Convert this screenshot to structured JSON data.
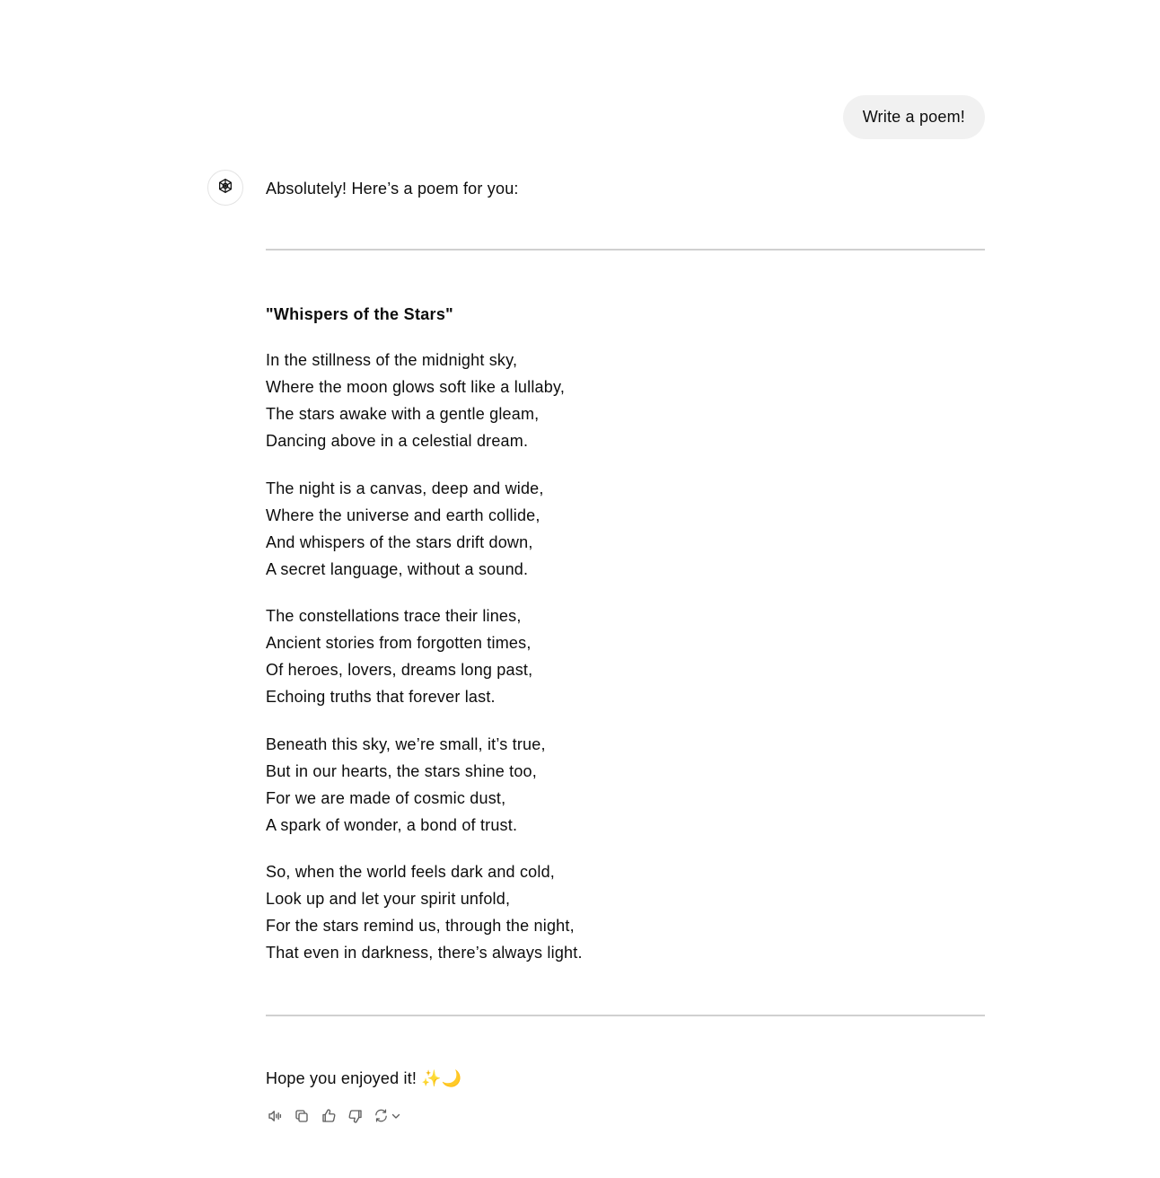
{
  "user_message": "Write a poem!",
  "assistant": {
    "avatar_icon": "openai-logo-icon",
    "intro": "Absolutely! Here’s a poem for you:",
    "poem_title": "\"Whispers of the Stars\"",
    "stanzas": [
      [
        "In the stillness of the midnight sky,",
        "Where the moon glows soft like a lullaby,",
        "The stars awake with a gentle gleam,",
        "Dancing above in a celestial dream."
      ],
      [
        "The night is a canvas, deep and wide,",
        "Where the universe and earth collide,",
        "And whispers of the stars drift down,",
        "A secret language, without a sound."
      ],
      [
        "The constellations trace their lines,",
        "Ancient stories from forgotten times,",
        "Of heroes, lovers, dreams long past,",
        "Echoing truths that forever last."
      ],
      [
        "Beneath this sky, we’re small, it’s true,",
        "But in our hearts, the stars shine too,",
        "For we are made of cosmic dust,",
        "A spark of wonder, a bond of trust."
      ],
      [
        "So, when the world feels dark and cold,",
        "Look up and let your spirit unfold,",
        "For the stars remind us, through the night,",
        "That even in darkness, there’s always light."
      ]
    ],
    "outro": "Hope you enjoyed it! ✨🌙"
  },
  "actions": [
    "read-aloud-icon",
    "copy-icon",
    "thumbs-up-icon",
    "thumbs-down-icon",
    "regenerate-icon",
    "chevron-down-icon"
  ]
}
